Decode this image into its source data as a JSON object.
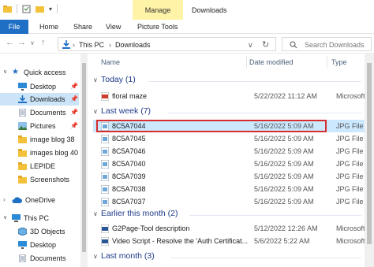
{
  "window": {
    "title": "Downloads",
    "manage_tab": "Manage"
  },
  "ribbon": {
    "file": "File",
    "tabs": [
      "Home",
      "Share",
      "View",
      "Picture Tools"
    ]
  },
  "address": {
    "crumbs": [
      "This PC",
      "Downloads"
    ],
    "search_placeholder": "Search Downloads"
  },
  "sidebar": {
    "items": [
      {
        "label": "Quick access",
        "icon": "star-icon",
        "pinned": false
      },
      {
        "label": "Desktop",
        "icon": "desktop-icon",
        "pinned": true
      },
      {
        "label": "Downloads",
        "icon": "download-icon",
        "pinned": true,
        "selected": true
      },
      {
        "label": "Documents",
        "icon": "documents-icon",
        "pinned": true
      },
      {
        "label": "Pictures",
        "icon": "pictures-icon",
        "pinned": true
      },
      {
        "label": "image blog 38",
        "icon": "folder-icon",
        "pinned": false
      },
      {
        "label": "images blog 40",
        "icon": "folder-icon",
        "pinned": false
      },
      {
        "label": "LEPIDE",
        "icon": "folder-icon",
        "pinned": false
      },
      {
        "label": "Screenshots",
        "icon": "folder-icon",
        "pinned": false
      },
      {
        "label": "OneDrive",
        "icon": "cloud-icon",
        "pinned": false
      },
      {
        "label": "This PC",
        "icon": "pc-icon",
        "pinned": false
      },
      {
        "label": "3D Objects",
        "icon": "cube-icon",
        "pinned": false
      },
      {
        "label": "Desktop",
        "icon": "desktop-icon",
        "pinned": false
      },
      {
        "label": "Documents",
        "icon": "documents-icon",
        "pinned": false
      }
    ]
  },
  "columns": {
    "name": "Name",
    "date": "Date modified",
    "type": "Type"
  },
  "groups": [
    {
      "label": "Today (1)",
      "rows": [
        {
          "name": "floral maze",
          "date": "5/22/2022 11:12 AM",
          "type": "Microsoft I",
          "icon": "pdf-icon"
        }
      ]
    },
    {
      "label": "Last week (7)",
      "rows": [
        {
          "name": "8C5A7044",
          "date": "5/16/2022 5:09 AM",
          "type": "JPG File",
          "icon": "image-file-icon",
          "selected": true
        },
        {
          "name": "8C5A7045",
          "date": "5/16/2022 5:09 AM",
          "type": "JPG File",
          "icon": "image-file-icon"
        },
        {
          "name": "8C5A7046",
          "date": "5/16/2022 5:09 AM",
          "type": "JPG File",
          "icon": "image-file-icon"
        },
        {
          "name": "8C5A7040",
          "date": "5/16/2022 5:09 AM",
          "type": "JPG File",
          "icon": "image-file-icon"
        },
        {
          "name": "8C5A7039",
          "date": "5/16/2022 5:09 AM",
          "type": "JPG File",
          "icon": "image-file-icon"
        },
        {
          "name": "8C5A7038",
          "date": "5/16/2022 5:09 AM",
          "type": "JPG File",
          "icon": "image-file-icon"
        },
        {
          "name": "8C5A7037",
          "date": "5/16/2022 5:09 AM",
          "type": "JPG File",
          "icon": "image-file-icon"
        }
      ]
    },
    {
      "label": "Earlier this month (2)",
      "rows": [
        {
          "name": "G2Page-Tool description",
          "date": "5/12/2022 12:26 AM",
          "type": "Microsoft I",
          "icon": "word-icon"
        },
        {
          "name": "Video Script - Resolve the 'Auth Certificat...",
          "date": "5/6/2022 5:22 AM",
          "type": "Microsoft I",
          "icon": "word-icon"
        }
      ]
    },
    {
      "label": "Last month (3)",
      "rows": []
    }
  ],
  "colors": {
    "accent": "#1f6fc5",
    "manage": "#fff3a8",
    "highlight_border": "#d62d2d",
    "selection": "#cce8ff",
    "group_text": "#1e3a8a"
  }
}
